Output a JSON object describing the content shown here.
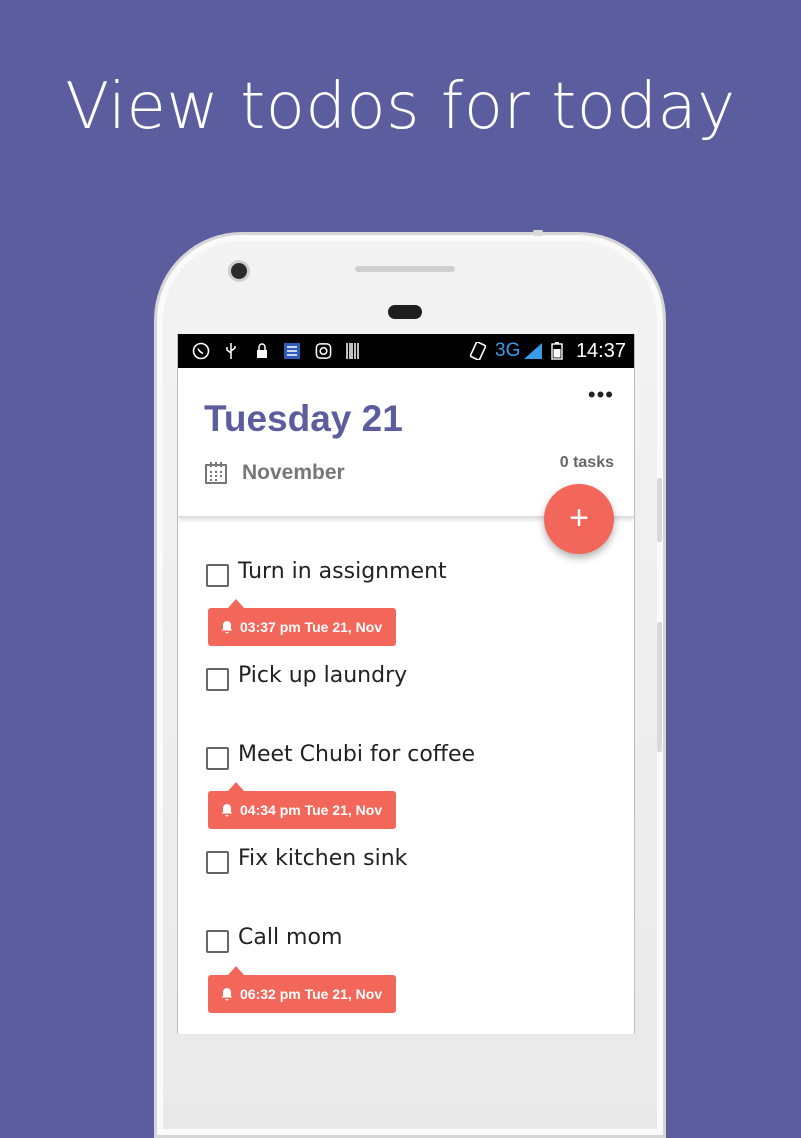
{
  "headline": "View todos for today",
  "statusbar": {
    "network": "3G",
    "time": "14:37",
    "icons": [
      "whatsapp-icon",
      "usb-icon",
      "lock-icon",
      "list-app-icon",
      "instagram-icon",
      "barcode-icon",
      "rotate-icon",
      "signal-icon",
      "battery-icon"
    ]
  },
  "header": {
    "date_title": "Tuesday 21",
    "month": "November",
    "task_count": "0 tasks",
    "menu": "•••"
  },
  "fab_label": "+",
  "tasks": [
    {
      "label": "Turn in assignment",
      "reminder": "03:37 pm Tue 21, Nov"
    },
    {
      "label": "Pick up laundry",
      "reminder": ""
    },
    {
      "label": "Meet Chubi for coffee",
      "reminder": "04:34 pm Tue 21, Nov"
    },
    {
      "label": "Fix kitchen sink",
      "reminder": ""
    },
    {
      "label": "Call mom",
      "reminder": "06:32 pm Tue 21, Nov"
    }
  ],
  "colors": {
    "background": "#5b5d9e",
    "accent": "#f2675a",
    "title": "#5b5d9e"
  }
}
